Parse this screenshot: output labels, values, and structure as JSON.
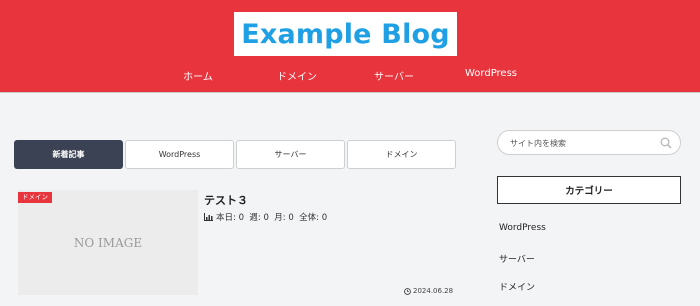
{
  "header": {
    "logo": "Example Blog",
    "nav": [
      "ホーム",
      "ドメイン",
      "サーバー",
      "WordPress"
    ]
  },
  "tabs": [
    {
      "label": "新着記事",
      "active": true
    },
    {
      "label": "WordPress",
      "active": false
    },
    {
      "label": "サーバー",
      "active": false
    },
    {
      "label": "ドメイン",
      "active": false
    }
  ],
  "post": {
    "category": "ドメイン",
    "thumbnail_text": "NO IMAGE",
    "title": "テスト３",
    "views": "本日: 0  週: 0  月: 0  全体: 0",
    "date": "2024.06.28"
  },
  "sidebar": {
    "search_placeholder": "サイト内を検索",
    "widget_title": "カテゴリー",
    "categories": [
      "WordPress",
      "サーバー",
      "ドメイン"
    ]
  },
  "colors": {
    "brand_red": "#e8343d",
    "logo_blue": "#1fa0e4",
    "active_tab": "#3b4253"
  }
}
